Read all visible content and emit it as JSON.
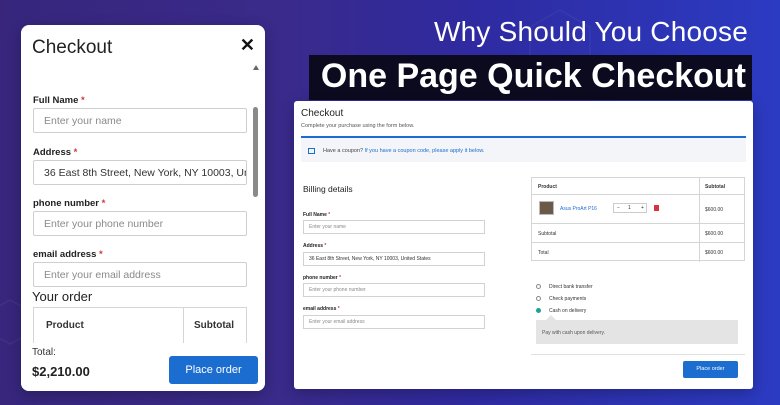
{
  "headline": {
    "line1": "Why Should You Choose",
    "line2": "One Page Quick Checkout"
  },
  "modal": {
    "title": "Checkout",
    "close_icon": "close-icon",
    "fields": [
      {
        "label": "Full Name",
        "required_mark": "*",
        "placeholder": "Enter your name",
        "value": ""
      },
      {
        "label": "Address",
        "required_mark": "*",
        "placeholder": "",
        "value": "36 East 8th Street, New York, NY 10003, Uni"
      },
      {
        "label": "phone number",
        "required_mark": "*",
        "placeholder": "Enter your phone number",
        "value": ""
      },
      {
        "label": "email address",
        "required_mark": "*",
        "placeholder": "Enter your email address",
        "value": ""
      }
    ],
    "your_order": "Your order",
    "table_headers": {
      "product": "Product",
      "subtotal": "Subtotal"
    },
    "total_label": "Total:",
    "total_value": "$2,210.00",
    "place_order": "Place order"
  },
  "page": {
    "title": "Checkout",
    "subtitle": "Complete your purchase using the form below.",
    "coupon_text": "Have a coupon?",
    "coupon_link": "If you have a coupon code, please apply it below.",
    "billing_heading": "Billing details",
    "fields": [
      {
        "label": "Full Name",
        "required_mark": "*",
        "placeholder": "Enter your name",
        "value": ""
      },
      {
        "label": "Address",
        "required_mark": "*",
        "placeholder": "",
        "value": "36 East 8th Street, New York, NY 10003, United States"
      },
      {
        "label": "phone number",
        "required_mark": "*",
        "placeholder": "Enter your phone number",
        "value": ""
      },
      {
        "label": "email address",
        "required_mark": "*",
        "placeholder": "Enter your email address",
        "value": ""
      }
    ],
    "order": {
      "headers": {
        "product": "Product",
        "subtotal": "Subtotal"
      },
      "item": {
        "name": "Asus ProArt P16",
        "qty": "1",
        "price": "$600.00"
      },
      "subtotal_label": "Subtotal",
      "subtotal_value": "$600.00",
      "total_label": "Total",
      "total_value": "$600.00"
    },
    "payment": {
      "options": [
        "Direct bank transfer",
        "Check payments",
        "Cash on delivery"
      ],
      "selected_index": 2,
      "description": "Pay with cash upon delivery."
    },
    "place_order": "Place order"
  },
  "colors": {
    "accent": "#1c6dd0",
    "required": "#d63638",
    "radio_selected": "#1aa39a"
  }
}
